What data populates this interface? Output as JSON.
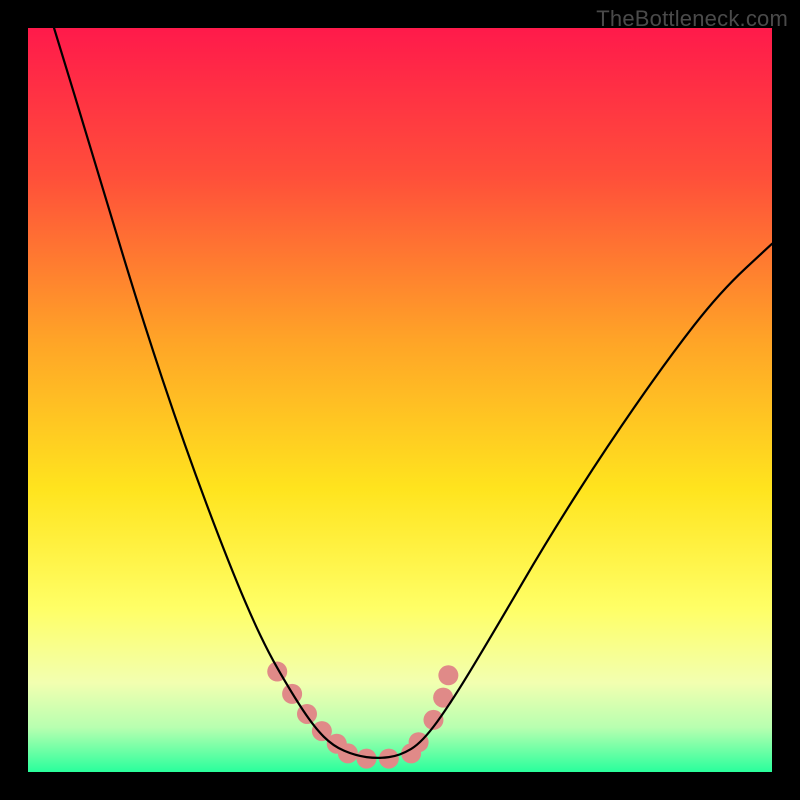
{
  "watermark": "TheBottleneck.com",
  "chart_data": {
    "type": "line",
    "title": "",
    "xlabel": "",
    "ylabel": "",
    "x_range": [
      0,
      1
    ],
    "y_range": [
      0,
      1
    ],
    "background": {
      "type": "vertical-gradient",
      "stops": [
        {
          "pos": 0.0,
          "color": "#ff1a4b"
        },
        {
          "pos": 0.2,
          "color": "#ff4f3a"
        },
        {
          "pos": 0.42,
          "color": "#ffa427"
        },
        {
          "pos": 0.62,
          "color": "#ffe41e"
        },
        {
          "pos": 0.78,
          "color": "#ffff66"
        },
        {
          "pos": 0.88,
          "color": "#f2ffb0"
        },
        {
          "pos": 0.94,
          "color": "#b8ffb0"
        },
        {
          "pos": 1.0,
          "color": "#29ff9c"
        }
      ]
    },
    "series": [
      {
        "name": "bottleneck-curve",
        "stroke": "#000000",
        "stroke_width": 2.2,
        "x": [
          0.035,
          0.09,
          0.15,
          0.21,
          0.27,
          0.315,
          0.355,
          0.385,
          0.41,
          0.44,
          0.47,
          0.5,
          0.53,
          0.57,
          0.63,
          0.7,
          0.78,
          0.86,
          0.93,
          1.0
        ],
        "y": [
          1.0,
          0.82,
          0.62,
          0.44,
          0.28,
          0.175,
          0.105,
          0.06,
          0.035,
          0.022,
          0.018,
          0.022,
          0.04,
          0.095,
          0.195,
          0.315,
          0.44,
          0.555,
          0.645,
          0.71
        ]
      },
      {
        "name": "highlight-dots",
        "type": "scatter",
        "color": "#e08a88",
        "radius": 10,
        "x": [
          0.335,
          0.355,
          0.375,
          0.395,
          0.415,
          0.43,
          0.455,
          0.485,
          0.515,
          0.525,
          0.545,
          0.558,
          0.565
        ],
        "y": [
          0.135,
          0.105,
          0.078,
          0.055,
          0.038,
          0.025,
          0.018,
          0.018,
          0.025,
          0.04,
          0.07,
          0.1,
          0.13
        ]
      }
    ]
  }
}
